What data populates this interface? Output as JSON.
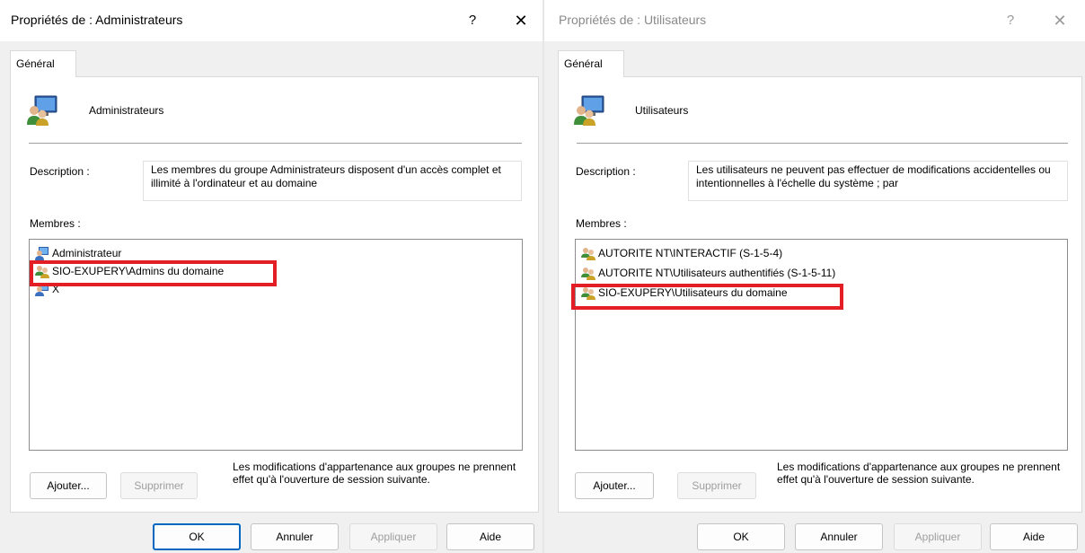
{
  "left_dialog": {
    "title": "Propriétés de : Administrateurs",
    "help": "?",
    "close": "✕",
    "tab": "Général",
    "group_name": "Administrateurs",
    "description_label": "Description :",
    "description": "Les membres du groupe Administrateurs disposent d'un accès complet et illimité à l'ordinateur et au domaine",
    "members_label": "Membres :",
    "members": [
      {
        "name": "Administrateur",
        "icon": "user-icon"
      },
      {
        "name": "SIO-EXUPERY\\Admins du domaine",
        "icon": "group-icon"
      },
      {
        "name": "X",
        "icon": "user-icon"
      }
    ],
    "add_button": "Ajouter...",
    "remove_button": "Supprimer",
    "note": "Les modifications d'appartenance aux groupes ne prennent effet qu'à l'ouverture de session suivante.",
    "ok_button": "OK",
    "cancel_button": "Annuler",
    "apply_button": "Appliquer",
    "help_button": "Aide"
  },
  "right_dialog": {
    "title": "Propriétés de : Utilisateurs",
    "help": "?",
    "close": "✕",
    "tab": "Général",
    "group_name": "Utilisateurs",
    "description_label": "Description :",
    "description": "Les utilisateurs ne peuvent pas effectuer de modifications accidentelles ou intentionnelles à l'échelle du système ; par",
    "members_label": "Membres :",
    "members": [
      {
        "name": "AUTORITE NT\\INTERACTIF (S-1-5-4)",
        "icon": "group-icon"
      },
      {
        "name": "AUTORITE NT\\Utilisateurs authentifiés (S-1-5-11)",
        "icon": "group-icon"
      },
      {
        "name": "SIO-EXUPERY\\Utilisateurs du domaine",
        "icon": "group-icon"
      }
    ],
    "add_button": "Ajouter...",
    "remove_button": "Supprimer",
    "note": "Les modifications d'appartenance aux groupes ne prennent effet qu'à l'ouverture de session suivante.",
    "ok_button": "OK",
    "cancel_button": "Annuler",
    "apply_button": "Appliquer",
    "help_button": "Aide"
  },
  "colors": {
    "highlight": "#e31e24",
    "accent": "#0067c0"
  }
}
